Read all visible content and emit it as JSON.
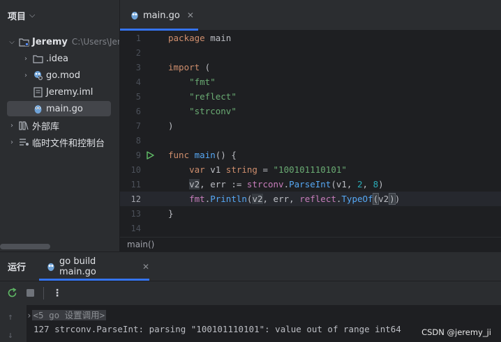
{
  "project": {
    "title": "项目",
    "tree": [
      {
        "label": "Jeremy",
        "hint": "C:\\Users\\Jer",
        "icon": "folder-icon"
      },
      {
        "label": ".idea",
        "icon": "folder-icon"
      },
      {
        "label": "go.mod",
        "icon": "go-mod-icon"
      },
      {
        "label": "Jeremy.iml",
        "icon": "file-icon"
      },
      {
        "label": "main.go",
        "icon": "gopher-icon",
        "selected": true
      },
      {
        "label": "外部库",
        "icon": "library-icon"
      },
      {
        "label": "临时文件和控制台",
        "icon": "scratches-icon"
      }
    ]
  },
  "editor": {
    "tab": {
      "label": "main.go",
      "close": "✕"
    },
    "line_numbers": [
      "1",
      "2",
      "3",
      "4",
      "5",
      "6",
      "7",
      "8",
      "9",
      "10",
      "11",
      "12",
      "13",
      "14"
    ],
    "current_line": "12",
    "breadcrumb": "main()"
  },
  "run": {
    "title": "运行",
    "tab_label": "go build main.go",
    "tab_close": "✕",
    "toolbar": {
      "rerun": "rerun-icon",
      "stop": "stop-icon",
      "more": "more-icon"
    },
    "console": {
      "collapsed": "<5 go 设置调用>",
      "output": "127 strconv.ParseInt: parsing \"100101110101\": value out of range int64"
    }
  },
  "watermark": "CSDN @jeremy_ji",
  "colors": {
    "accent": "#3574f0",
    "keyword": "#cf8e6d",
    "string": "#6aab73",
    "number": "#2aacb8",
    "function": "#56a8f5"
  }
}
